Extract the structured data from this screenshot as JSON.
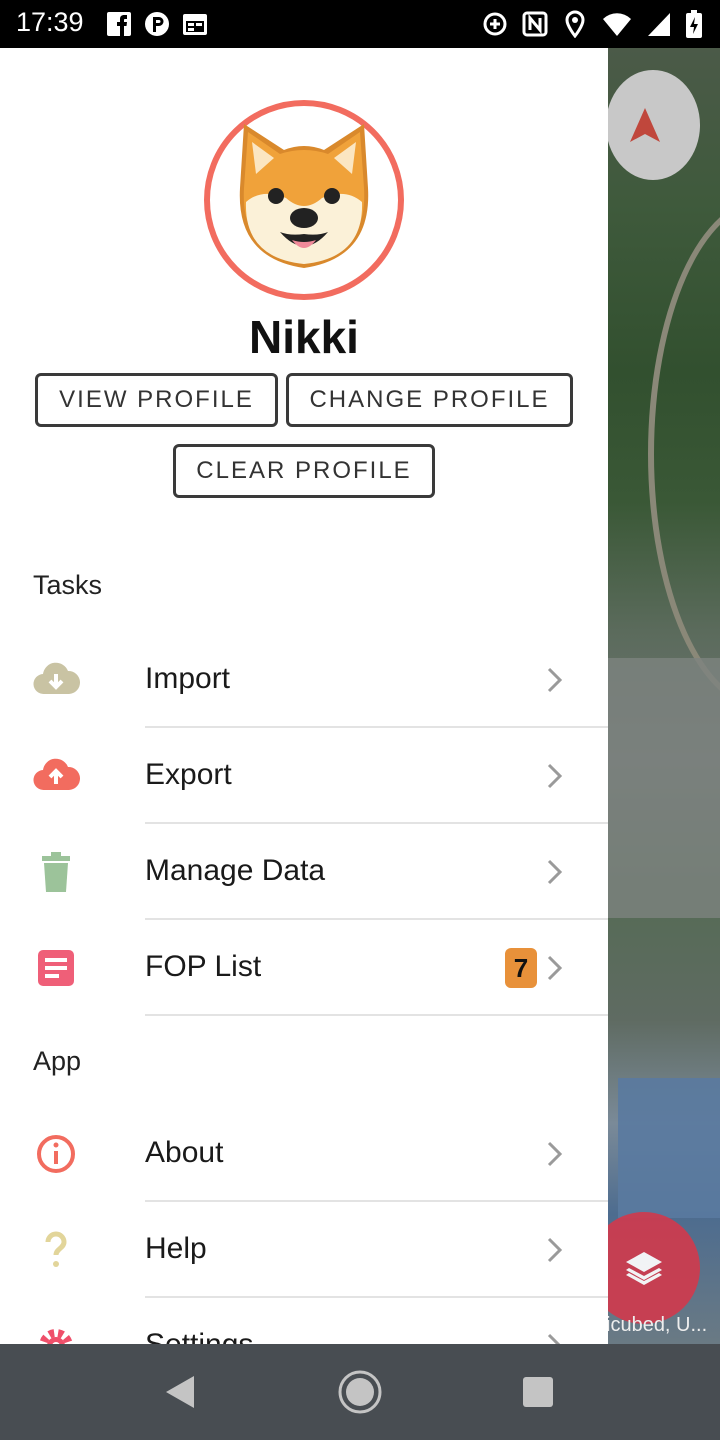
{
  "status_bar": {
    "time": "17:39",
    "left_icons": [
      "facebook-icon",
      "p-app-icon",
      "calendar-icon"
    ],
    "right_icons": [
      "data-saver-icon",
      "nfc-icon",
      "location-icon",
      "wifi-icon",
      "cell-signal-icon",
      "battery-icon"
    ]
  },
  "profile": {
    "name": "Nikki",
    "avatar": "shiba-dog-avatar",
    "view_label": "VIEW PROFILE",
    "change_label": "CHANGE PROFILE",
    "clear_label": "CLEAR PROFILE"
  },
  "sections": {
    "tasks": {
      "title": "Tasks",
      "items": [
        {
          "label": "Import",
          "icon": "cloud-download-icon",
          "color": "#c9c3a3"
        },
        {
          "label": "Export",
          "icon": "cloud-upload-icon",
          "color": "#f26c5f"
        },
        {
          "label": "Manage Data",
          "icon": "trash-icon",
          "color": "#9cc39a"
        },
        {
          "label": "FOP List",
          "icon": "list-document-icon",
          "color": "#ef5f78",
          "badge": "7"
        }
      ]
    },
    "app": {
      "title": "App",
      "items": [
        {
          "label": "About",
          "icon": "info-icon",
          "color": "#f26c5f"
        },
        {
          "label": "Help",
          "icon": "question-icon",
          "color": "#e2d59a"
        },
        {
          "label": "Settings",
          "icon": "gear-icon",
          "color": "#ef4f6a"
        }
      ]
    }
  },
  "map": {
    "attribution": "icubed, U...",
    "compass_icon": "navigation-arrow-icon",
    "layers_icon": "layers-icon"
  },
  "colors": {
    "accent": "#f26c5f",
    "badge": "#e8913a",
    "nav_bar": "#484d52"
  },
  "nav_bar": {
    "icons": [
      "back-icon",
      "home-icon",
      "recents-icon"
    ]
  }
}
